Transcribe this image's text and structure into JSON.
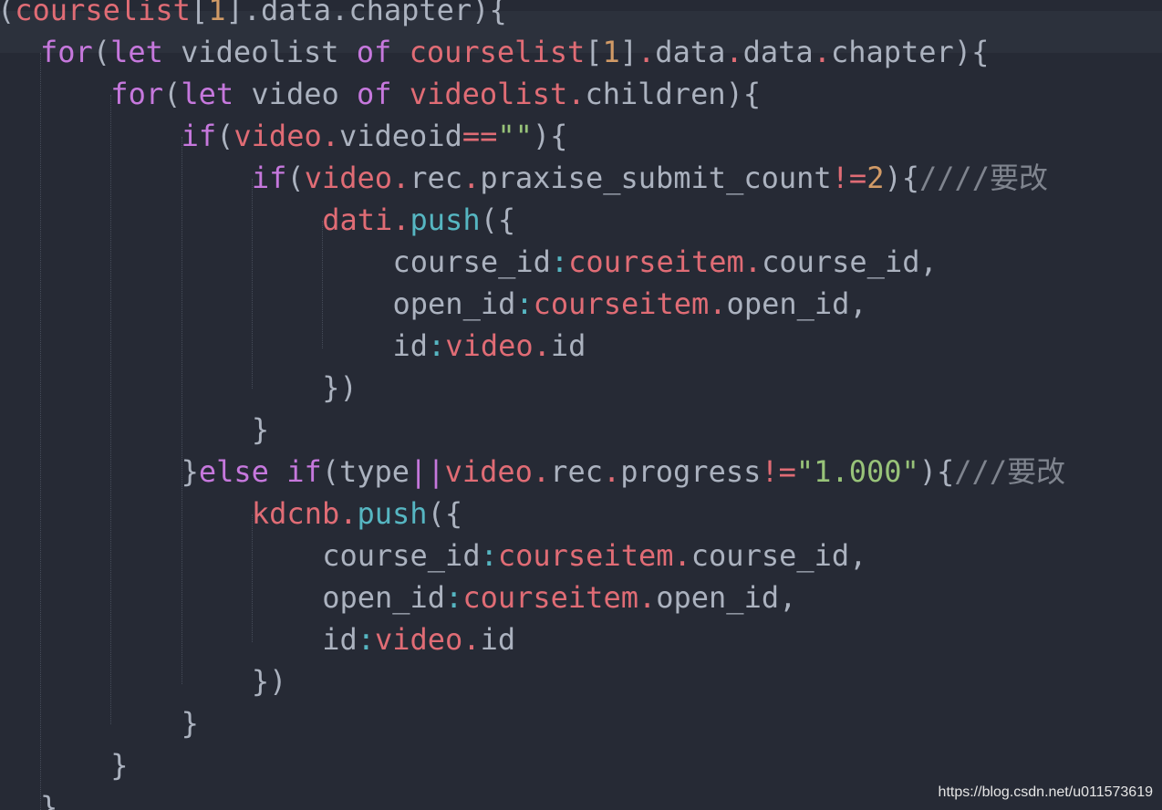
{
  "colors": {
    "background": "#262a35",
    "current_line": "#2c313c",
    "keyword": "#c678dd",
    "variable": "#e06c75",
    "function": "#56b6c2",
    "number": "#d19a66",
    "string": "#98c379",
    "comment": "#7f848e",
    "plain": "#abb2bf"
  },
  "editor": {
    "lines": [
      {
        "indent": 0,
        "tokens": [
          {
            "t": "(",
            "k": "plain"
          },
          {
            "t": "courselist",
            "k": "variable"
          },
          {
            "t": "[",
            "k": "plain"
          },
          {
            "t": "1",
            "k": "number"
          },
          {
            "t": "].",
            "k": "plain"
          },
          {
            "t": "data",
            "k": "plain"
          },
          {
            "t": ".",
            "k": "plain"
          },
          {
            "t": "chapter",
            "k": "plain"
          },
          {
            "t": "){",
            "k": "plain"
          }
        ]
      },
      {
        "indent": 1,
        "tokens": [
          {
            "t": "for",
            "k": "keyword"
          },
          {
            "t": "(",
            "k": "plain"
          },
          {
            "t": "let",
            "k": "keyword"
          },
          {
            "t": " videolist ",
            "k": "plain"
          },
          {
            "t": "of",
            "k": "keyword"
          },
          {
            "t": " ",
            "k": "plain"
          },
          {
            "t": "courselist",
            "k": "variable"
          },
          {
            "t": "[",
            "k": "plain"
          },
          {
            "t": "1",
            "k": "number"
          },
          {
            "t": "]",
            "k": "plain"
          },
          {
            "t": ".",
            "k": "variable"
          },
          {
            "t": "data",
            "k": "plain"
          },
          {
            "t": ".",
            "k": "variable"
          },
          {
            "t": "data",
            "k": "plain"
          },
          {
            "t": ".",
            "k": "variable"
          },
          {
            "t": "chapter){",
            "k": "plain"
          }
        ]
      },
      {
        "indent": 2,
        "tokens": [
          {
            "t": "for",
            "k": "keyword"
          },
          {
            "t": "(",
            "k": "plain"
          },
          {
            "t": "let",
            "k": "keyword"
          },
          {
            "t": " video ",
            "k": "plain"
          },
          {
            "t": "of",
            "k": "keyword"
          },
          {
            "t": " ",
            "k": "plain"
          },
          {
            "t": "videolist",
            "k": "variable"
          },
          {
            "t": ".",
            "k": "variable"
          },
          {
            "t": "children){",
            "k": "plain"
          }
        ]
      },
      {
        "indent": 3,
        "tokens": [
          {
            "t": "if",
            "k": "keyword"
          },
          {
            "t": "(",
            "k": "plain"
          },
          {
            "t": "video",
            "k": "variable"
          },
          {
            "t": ".",
            "k": "variable"
          },
          {
            "t": "videoid",
            "k": "plain"
          },
          {
            "t": "==",
            "k": "variable"
          },
          {
            "t": "\"\"",
            "k": "string"
          },
          {
            "t": "){",
            "k": "plain"
          }
        ]
      },
      {
        "indent": 4,
        "tokens": [
          {
            "t": "if",
            "k": "keyword"
          },
          {
            "t": "(",
            "k": "plain"
          },
          {
            "t": "video",
            "k": "variable"
          },
          {
            "t": ".",
            "k": "variable"
          },
          {
            "t": "rec",
            "k": "plain"
          },
          {
            "t": ".",
            "k": "variable"
          },
          {
            "t": "praxise_submit_count",
            "k": "plain"
          },
          {
            "t": "!=",
            "k": "variable"
          },
          {
            "t": "2",
            "k": "number"
          },
          {
            "t": "){",
            "k": "plain"
          },
          {
            "t": "////要改",
            "k": "comment"
          }
        ]
      },
      {
        "indent": 5,
        "tokens": [
          {
            "t": "dati",
            "k": "variable"
          },
          {
            "t": ".",
            "k": "variable"
          },
          {
            "t": "push",
            "k": "function"
          },
          {
            "t": "({",
            "k": "plain"
          }
        ]
      },
      {
        "indent": 6,
        "tokens": [
          {
            "t": "course_id",
            "k": "plain"
          },
          {
            "t": ":",
            "k": "function"
          },
          {
            "t": "courseitem",
            "k": "variable"
          },
          {
            "t": ".",
            "k": "variable"
          },
          {
            "t": "course_id,",
            "k": "plain"
          }
        ]
      },
      {
        "indent": 6,
        "tokens": [
          {
            "t": "open_id",
            "k": "plain"
          },
          {
            "t": ":",
            "k": "function"
          },
          {
            "t": "courseitem",
            "k": "variable"
          },
          {
            "t": ".",
            "k": "variable"
          },
          {
            "t": "open_id,",
            "k": "plain"
          }
        ]
      },
      {
        "indent": 6,
        "tokens": [
          {
            "t": "id",
            "k": "plain"
          },
          {
            "t": ":",
            "k": "function"
          },
          {
            "t": "video",
            "k": "variable"
          },
          {
            "t": ".",
            "k": "variable"
          },
          {
            "t": "id",
            "k": "plain"
          }
        ]
      },
      {
        "indent": 5,
        "tokens": [
          {
            "t": "})",
            "k": "plain"
          }
        ]
      },
      {
        "indent": 4,
        "tokens": [
          {
            "t": "}",
            "k": "plain"
          }
        ]
      },
      {
        "indent": 3,
        "tokens": [
          {
            "t": "}",
            "k": "plain"
          },
          {
            "t": "else",
            "k": "keyword"
          },
          {
            "t": " ",
            "k": "plain"
          },
          {
            "t": "if",
            "k": "keyword"
          },
          {
            "t": "(type",
            "k": "plain"
          },
          {
            "t": "||",
            "k": "keyword"
          },
          {
            "t": "video",
            "k": "variable"
          },
          {
            "t": ".",
            "k": "variable"
          },
          {
            "t": "rec",
            "k": "plain"
          },
          {
            "t": ".",
            "k": "variable"
          },
          {
            "t": "progress",
            "k": "plain"
          },
          {
            "t": "!=",
            "k": "variable"
          },
          {
            "t": "\"1.000\"",
            "k": "string"
          },
          {
            "t": "){",
            "k": "plain"
          },
          {
            "t": "///要改",
            "k": "comment"
          }
        ]
      },
      {
        "indent": 4,
        "tokens": [
          {
            "t": "kdcnb",
            "k": "variable"
          },
          {
            "t": ".",
            "k": "variable"
          },
          {
            "t": "push",
            "k": "function"
          },
          {
            "t": "({",
            "k": "plain"
          }
        ]
      },
      {
        "indent": 5,
        "tokens": [
          {
            "t": "course_id",
            "k": "plain"
          },
          {
            "t": ":",
            "k": "function"
          },
          {
            "t": "courseitem",
            "k": "variable"
          },
          {
            "t": ".",
            "k": "variable"
          },
          {
            "t": "course_id,",
            "k": "plain"
          }
        ]
      },
      {
        "indent": 5,
        "tokens": [
          {
            "t": "open_id",
            "k": "plain"
          },
          {
            "t": ":",
            "k": "function"
          },
          {
            "t": "courseitem",
            "k": "variable"
          },
          {
            "t": ".",
            "k": "variable"
          },
          {
            "t": "open_id,",
            "k": "plain"
          }
        ]
      },
      {
        "indent": 5,
        "tokens": [
          {
            "t": "id",
            "k": "plain"
          },
          {
            "t": ":",
            "k": "function"
          },
          {
            "t": "video",
            "k": "variable"
          },
          {
            "t": ".",
            "k": "variable"
          },
          {
            "t": "id",
            "k": "plain"
          }
        ]
      },
      {
        "indent": 4,
        "tokens": [
          {
            "t": "})",
            "k": "plain"
          }
        ]
      },
      {
        "indent": 3,
        "tokens": [
          {
            "t": "}",
            "k": "plain"
          }
        ]
      },
      {
        "indent": 2,
        "tokens": [
          {
            "t": "}",
            "k": "plain"
          }
        ]
      },
      {
        "indent": 1,
        "tokens": [
          {
            "t": "}",
            "k": "plain"
          }
        ]
      }
    ]
  },
  "watermark": "https://blog.csdn.net/u011573619"
}
